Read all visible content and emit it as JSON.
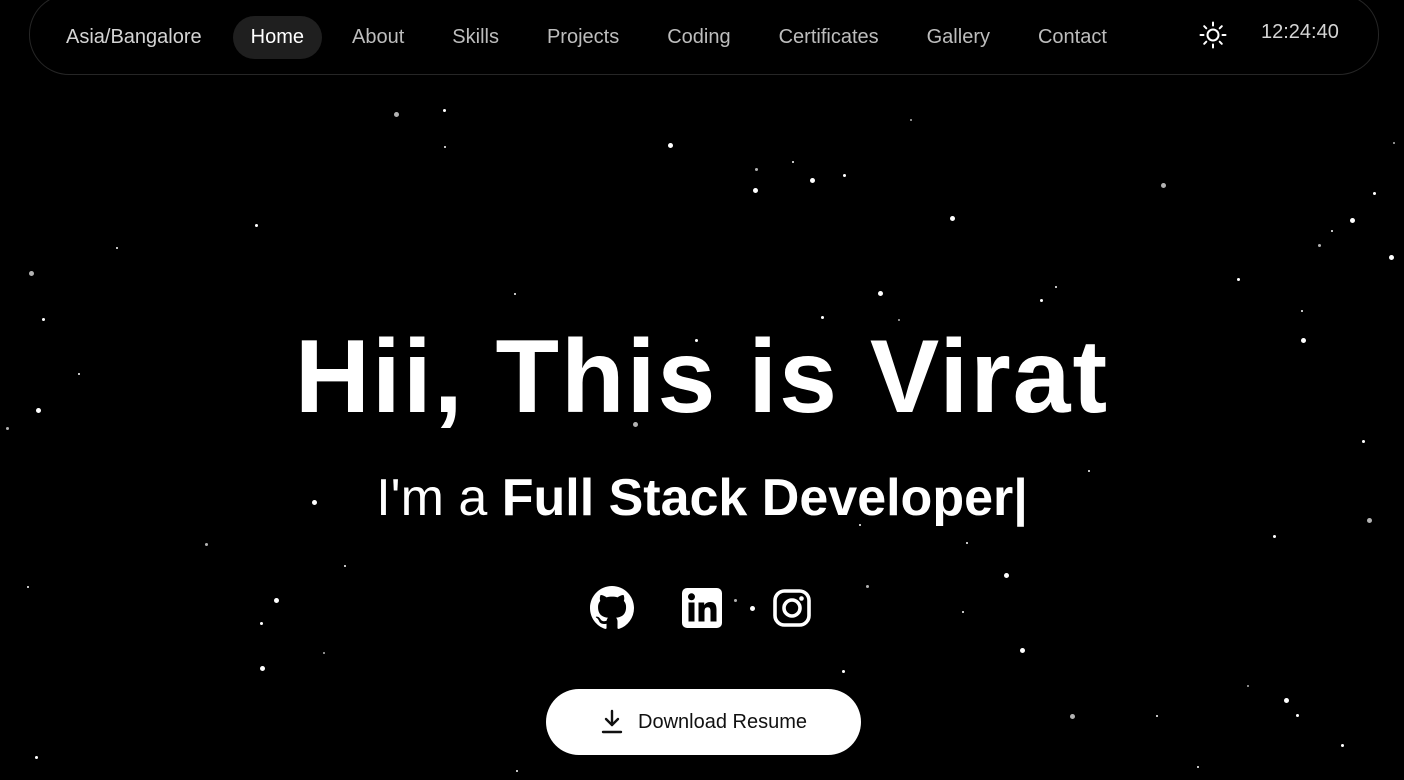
{
  "nav": {
    "timezone": "Asia/Bangalore",
    "links": [
      "Home",
      "About",
      "Skills",
      "Projects",
      "Coding",
      "Certificates",
      "Gallery",
      "Contact"
    ],
    "active": "Home",
    "theme_icon": "sun-icon",
    "time": "12:24:40"
  },
  "hero": {
    "title": "Hii, This is Virat",
    "subtitle_prefix": "I'm a ",
    "subtitle_role": "Full Stack Developer|"
  },
  "socials": [
    {
      "icon": "github-icon"
    },
    {
      "icon": "linkedin-icon"
    },
    {
      "icon": "instagram-icon"
    }
  ],
  "cta": {
    "label": "Download Resume",
    "icon": "download-icon"
  },
  "colors": {
    "background": "#000000",
    "text": "#ffffff",
    "nav_active_bg": "#1f1f1f",
    "button_bg": "#ffffff"
  }
}
